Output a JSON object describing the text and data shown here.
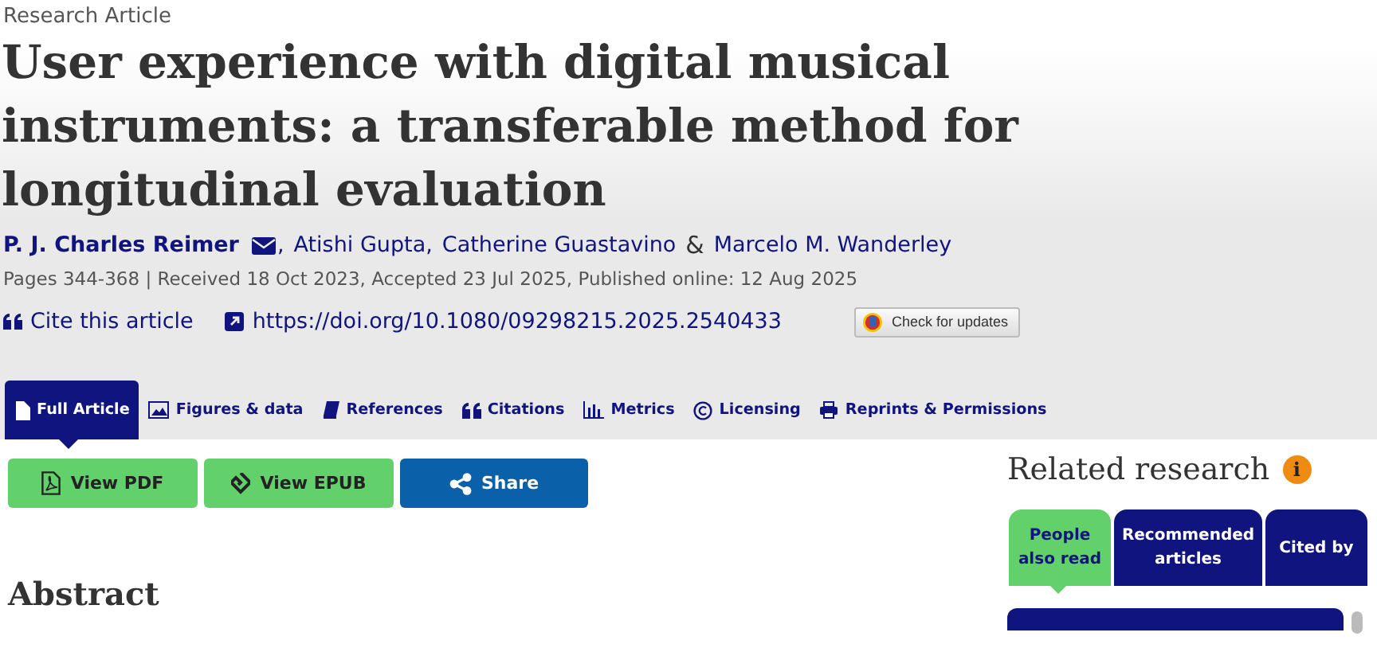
{
  "article_type": "Research Article",
  "title": "User experience with digital musical instruments: a transferable method for longitudinal evaluation",
  "authors": [
    {
      "name": "P. J. Charles Reimer",
      "corresponding": true,
      "separator": ","
    },
    {
      "name": "Atishi Gupta",
      "corresponding": false,
      "separator": ","
    },
    {
      "name": "Catherine Guastavino",
      "corresponding": false,
      "separator": "&"
    },
    {
      "name": "Marcelo M. Wanderley",
      "corresponding": false
    }
  ],
  "publication_info": "Pages 344-368 | Received 18 Oct 2023, Accepted 23 Jul 2025, Published online: 12 Aug 2025",
  "cite_link": "Cite this article",
  "doi_link": "https://doi.org/10.1080/09298215.2025.2540433",
  "updates_button": "Check for updates",
  "tabs": [
    {
      "label": "Full Article",
      "selected": true
    },
    {
      "label": "Figures & data",
      "selected": false
    },
    {
      "label": "References",
      "selected": false
    },
    {
      "label": "Citations",
      "selected": false
    },
    {
      "label": "Metrics",
      "selected": false
    },
    {
      "label": "Licensing",
      "selected": false
    },
    {
      "label": "Reprints & Permissions",
      "selected": false
    }
  ],
  "actions": [
    {
      "label": "View PDF",
      "kind": "pdf"
    },
    {
      "label": "View EPUB",
      "kind": "epub"
    },
    {
      "label": "Share",
      "kind": "share"
    }
  ],
  "abstract_heading": "Abstract",
  "related": {
    "title": "Related research",
    "info_icon": "i",
    "tabs": [
      {
        "label": "People also read",
        "selected": true
      },
      {
        "label": "Recommended articles",
        "selected": false
      },
      {
        "label": "Cited by",
        "selected": false
      }
    ]
  }
}
